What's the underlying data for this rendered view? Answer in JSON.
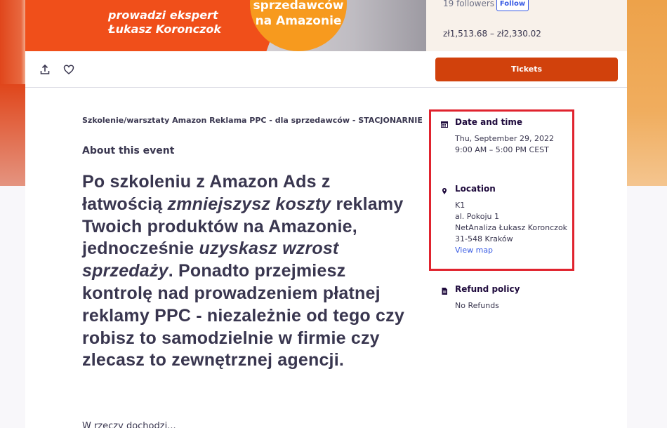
{
  "hero": {
    "line1": "prowadzi ekspert",
    "line2": "Łukasz Koronczok",
    "circle_line1": "sprzedawców",
    "circle_line2": "na Amazonie"
  },
  "organizer": {
    "followers": "19 followers",
    "follow_label": "Follow",
    "price_range": "zł1,513.68 – zł2,330.02"
  },
  "actions": {
    "share_icon": "share-icon",
    "like_icon": "heart-icon",
    "tickets_label": "Tickets"
  },
  "event": {
    "subtitle": "Szkolenie/warsztaty Amazon Reklama PPC - dla sprzedawców - STACJONARNIE",
    "about_heading": "About this event",
    "lead_parts": [
      "Po szkoleniu z Amazon Ads z łatwością ",
      "zmniejszysz koszty",
      " reklamy Twoich produktów na Amazonie, jednocześnie ",
      "uzyskasz wzrost sprzedaży",
      ". Ponadto przejmiesz kontrolę nad prowadzeniem płatnej reklamy PPC - niezależnie od tego czy robisz to samodzielnie w firmie czy zlecasz to zewnętrznej agencji."
    ],
    "next_line": "W rzeczy dochodzi..."
  },
  "sidebar": {
    "date": {
      "heading": "Date and time",
      "line1": "Thu, September 29, 2022",
      "line2": "9:00 AM – 5:00 PM CEST"
    },
    "location": {
      "heading": "Location",
      "line1": "K1",
      "line2": "al. Pokoju 1",
      "line3": "NetAnaliza Łukasz Koronczok",
      "line4": "31-548 Kraków",
      "map_link": "View map"
    },
    "refund": {
      "heading": "Refund policy",
      "text": "No Refunds"
    }
  },
  "colors": {
    "accent": "#d1410c",
    "link": "#3659e3",
    "highlight_border": "#e0232e"
  }
}
